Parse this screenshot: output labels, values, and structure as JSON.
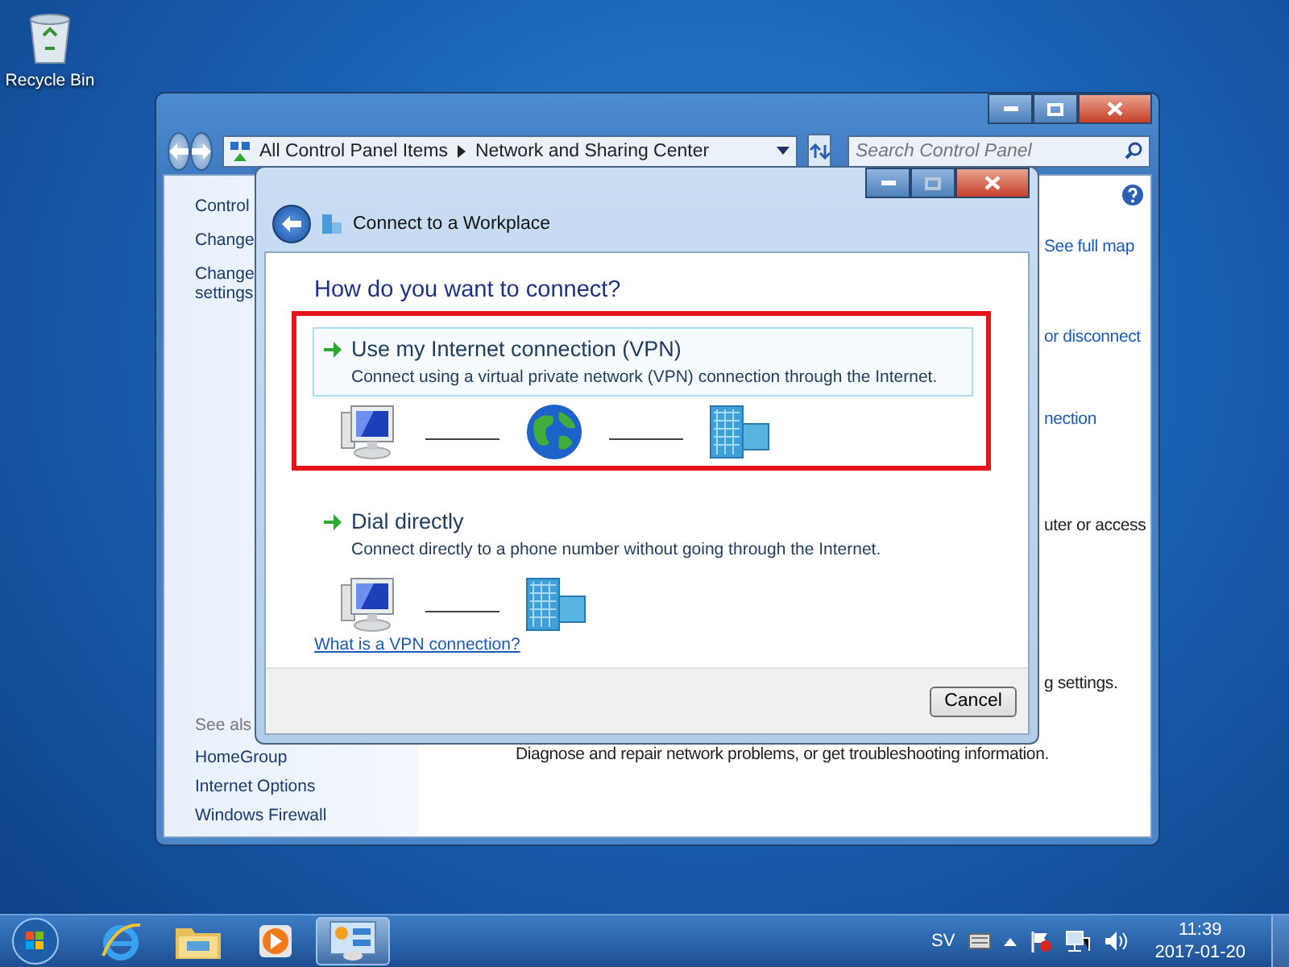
{
  "desktop": {
    "icons": [
      {
        "label": "Recycle Bin"
      }
    ]
  },
  "explorer": {
    "address": {
      "crumbs": [
        "All Control Panel Items",
        "Network and Sharing Center"
      ]
    },
    "search": {
      "placeholder": "Search Control Panel"
    },
    "sidebar": {
      "links": [
        {
          "lines": [
            "Control"
          ]
        },
        {
          "lines": [
            "Change"
          ]
        },
        {
          "lines": [
            "Change",
            "settings"
          ]
        }
      ],
      "see_also": {
        "heading": "See als",
        "links": [
          "HomeGroup",
          "Internet Options",
          "Windows Firewall"
        ]
      }
    },
    "content": [
      {
        "kind": "link",
        "text": "See full map"
      },
      {
        "kind": "link",
        "text": "or disconnect"
      },
      {
        "kind": "link",
        "text": "nection"
      },
      {
        "kind": "text",
        "text": "uter or access"
      },
      {
        "kind": "text",
        "text": "g settings."
      },
      {
        "kind": "text",
        "text": "Diagnose and repair network problems, or get troubleshooting information."
      }
    ]
  },
  "dialog": {
    "title": "Connect to a Workplace",
    "heading": "How do you want to connect?",
    "options": [
      {
        "kind": "vpn",
        "title": "Use my Internet connection (VPN)",
        "description": "Connect using a virtual private network (VPN) connection through the Internet.",
        "selected": true,
        "highlighted": true
      },
      {
        "kind": "dial",
        "title": "Dial directly",
        "description": "Connect directly to a phone number without going through the Internet.",
        "selected": false,
        "highlighted": false
      }
    ],
    "link": "What is a VPN connection?",
    "buttons": [
      "Cancel"
    ]
  },
  "taskbar": {
    "apps": [
      {
        "kind": "browser",
        "active": false
      },
      {
        "kind": "folder",
        "active": false
      },
      {
        "kind": "media",
        "active": false
      },
      {
        "kind": "control-panel",
        "active": true
      }
    ],
    "tray": {
      "language": "SV",
      "time": "11:39",
      "date": "2017-01-20"
    }
  }
}
